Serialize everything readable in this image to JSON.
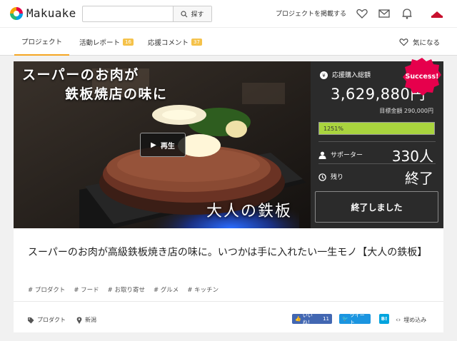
{
  "header": {
    "logo": "Makuake",
    "search_placeholder": "",
    "search_button": "探す",
    "post_project": "プロジェクトを掲載する"
  },
  "nav": {
    "tabs": [
      {
        "label": "プロジェクト"
      },
      {
        "label": "活動レポート",
        "badge": "16"
      },
      {
        "label": "応援コメント",
        "badge": "37"
      }
    ],
    "favorite": "気になる"
  },
  "hero": {
    "title_line1": "スーパーのお肉が",
    "title_line2": "鉄板焼店の味に",
    "caption": "大人の鉄板",
    "play_label": "再生"
  },
  "funding": {
    "raised_label": "応援購入総額",
    "amount": "3,629,880円",
    "goal": "目標金額 290,000円",
    "progress_label": "1251%",
    "progress": 1251,
    "supporters_label": "サポーター",
    "supporters": "330人",
    "remaining_label": "残り",
    "remaining": "終了",
    "status_button": "終了しました",
    "badge": "Success!"
  },
  "project": {
    "title": "スーパーのお肉が高級鉄板焼き店の味に。いつかは手に入れたい一生モノ【大人の鉄板】",
    "tags": [
      "# プロダクト",
      "# フード",
      "# お取り寄せ",
      "# グルメ",
      "# キッチン"
    ],
    "category": "プロダクト",
    "location": "新潟"
  },
  "share": {
    "like": "いいね！",
    "like_count": "11",
    "tweet": "ツイート",
    "hatena": "B!",
    "embed": "埋め込み"
  },
  "colors": {
    "accent": "#f5a623",
    "success": "#e6004c",
    "progress": "#a9d43e",
    "panel": "#2b2b2b"
  }
}
